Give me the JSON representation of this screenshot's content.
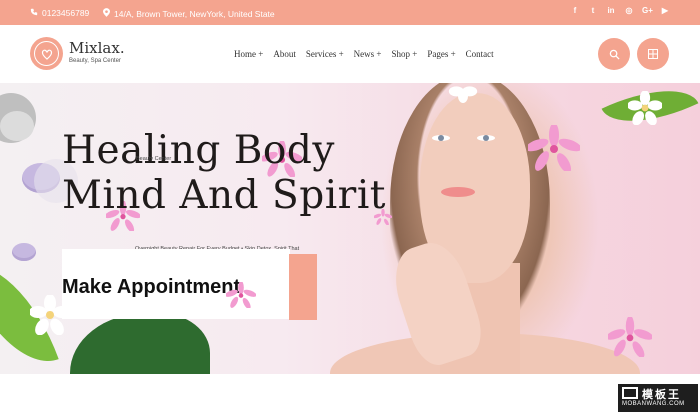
{
  "topbar": {
    "phone": "0123456789",
    "address": "14/A, Brown Tower, NewYork, United State",
    "socials": [
      {
        "icon": "facebook-icon",
        "glyph": "f"
      },
      {
        "icon": "twitter-icon",
        "glyph": "t"
      },
      {
        "icon": "linkedin-icon",
        "glyph": "in"
      },
      {
        "icon": "instagram-icon",
        "glyph": "◎"
      },
      {
        "icon": "google-plus-icon",
        "glyph": "G+"
      },
      {
        "icon": "youtube-icon",
        "glyph": "▶"
      }
    ]
  },
  "header": {
    "brand": "Mixlax.",
    "tagline": "Beauty, Spa Center",
    "nav": [
      "Home +",
      "About",
      "Services +",
      "News +",
      "Shop +",
      "Pages +",
      "Contact"
    ]
  },
  "hero": {
    "title_line1": "Healing Body",
    "title_line2": "Mind And Spirit",
    "overlay_caption": "Beauty Center",
    "overlay_sub": "Overnight Beauty Repair For Every Budget • Skin Detox, Spirit That",
    "appointment_label": "Make Appointment"
  },
  "watermark": {
    "big": "模板王",
    "small": "MOBANWANG.COM"
  },
  "colors": {
    "accent": "#f4a48f",
    "heading": "#1f1b1a"
  }
}
